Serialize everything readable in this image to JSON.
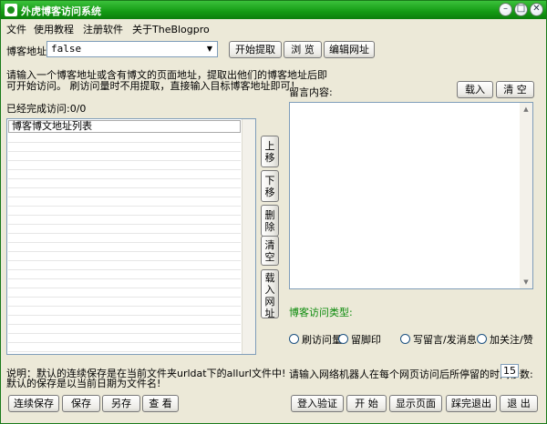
{
  "window": {
    "title": "外虎博客访问系统"
  },
  "titlebar": {
    "minimize": "–",
    "restore": "□",
    "close": "✕"
  },
  "menu": [
    "文件",
    "使用教程",
    "注册软件",
    "关于TheBlogpro"
  ],
  "url_row": {
    "label": "博客地址:",
    "value": "false",
    "extract_button": "开始提取",
    "browse_button": "浏 览",
    "edit_button": "编辑网址"
  },
  "instructions": {
    "line1": "请输入一个博客地址或含有博文的页面地址，提取出他们的博客地址后即",
    "line2": "可开始访问。  刷访问量时不用提取，直接输入目标博客地址即可！"
  },
  "visited": {
    "label": "已经完成访问:",
    "count": "0/0"
  },
  "url_list": {
    "header": "博客博文地址列表"
  },
  "side_buttons": {
    "move_up": [
      "上",
      "移"
    ],
    "move_down": [
      "下",
      "移"
    ],
    "delete": [
      "删",
      "除"
    ],
    "clear": [
      "清",
      "空"
    ],
    "load_url": [
      "载",
      "入",
      "网",
      "址"
    ]
  },
  "note": {
    "line1": "说明：默认的连续保存是在当前文件夹urldat下的allurl文件中!",
    "line2": "默认的保存是以当前日期为文件名!"
  },
  "bottom_left_buttons": {
    "continuous_save": "连续保存",
    "save": "保存",
    "save_as": "另存",
    "view": "查 看"
  },
  "message": {
    "label": "留言内容:",
    "load_button": "载入",
    "clear_button": "清 空"
  },
  "visit_type": {
    "label": "博客访问类型:",
    "options": [
      "刷访问量",
      "留脚印",
      "写留言/发消息",
      "加关注/赞"
    ]
  },
  "dwell": {
    "label": "请输入网络机器人在每个网页访问后所停留的时间秒数:",
    "seconds": "15"
  },
  "bottom_right_buttons": {
    "login": "登入验证",
    "start": "开 始",
    "show_page": "显示页面",
    "pause_exit": "踩完退出",
    "exit": "退 出"
  },
  "colors": {
    "title_green": "#139a13",
    "visit_type_label": "#0a8a0a"
  }
}
